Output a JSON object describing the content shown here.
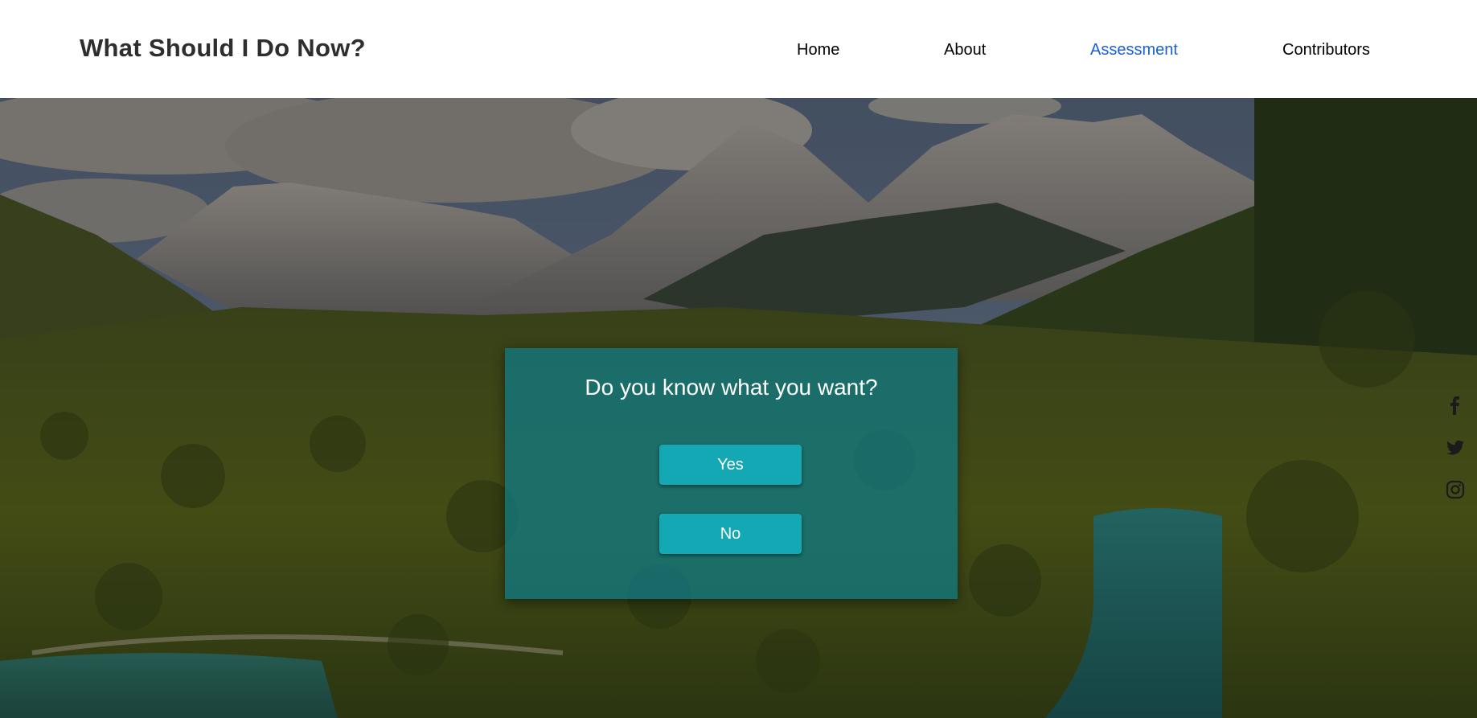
{
  "header": {
    "site_title": "What Should I Do Now?",
    "nav": [
      {
        "label": "Home",
        "active": false
      },
      {
        "label": "About",
        "active": false
      },
      {
        "label": "Assessment",
        "active": true
      },
      {
        "label": "Contributors",
        "active": false
      }
    ],
    "active_color": "#1a5fd6"
  },
  "assessment": {
    "question": "Do you know what you want?",
    "yes_label": "Yes",
    "no_label": "No",
    "card_color": "#12787f",
    "button_color": "#14a8b4"
  },
  "social": {
    "icons": [
      "facebook-icon",
      "twitter-icon",
      "instagram-icon"
    ]
  },
  "background": {
    "scene": "mountain-lake-forest-photo"
  }
}
